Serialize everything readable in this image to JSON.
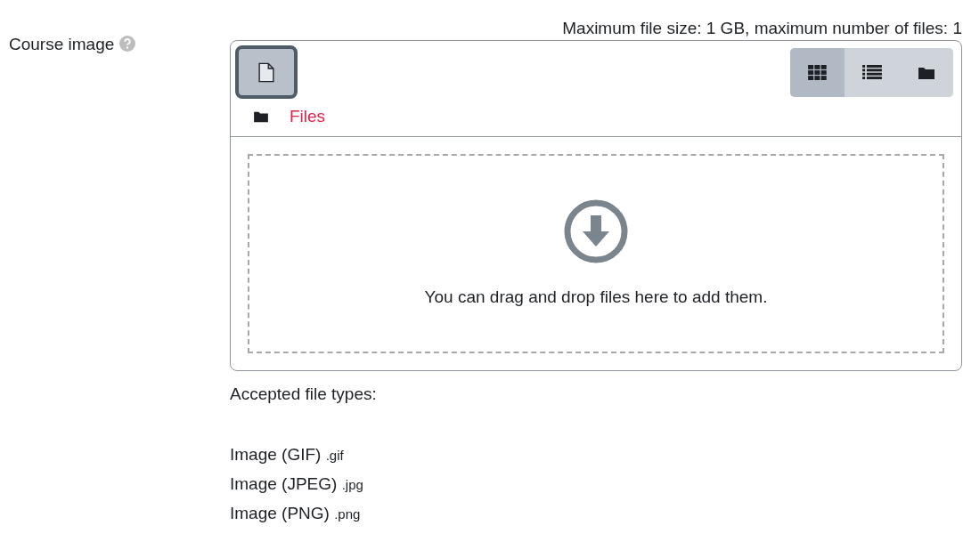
{
  "field": {
    "label": "Course image"
  },
  "limits": "Maximum file size: 1 GB, maximum number of files: 1",
  "view_modes": [
    {
      "kind": "grid",
      "selected": true
    },
    {
      "kind": "list",
      "selected": false
    },
    {
      "kind": "tree",
      "selected": false
    }
  ],
  "path": "Files",
  "dropzone": "You can drag and drop files here to add them.",
  "accepted": {
    "heading": "Accepted file types:",
    "types": [
      {
        "name": "Image (GIF)",
        "ext": ".gif"
      },
      {
        "name": "Image (JPEG)",
        "ext": ".jpg"
      },
      {
        "name": "Image (PNG)",
        "ext": ".png"
      }
    ]
  }
}
